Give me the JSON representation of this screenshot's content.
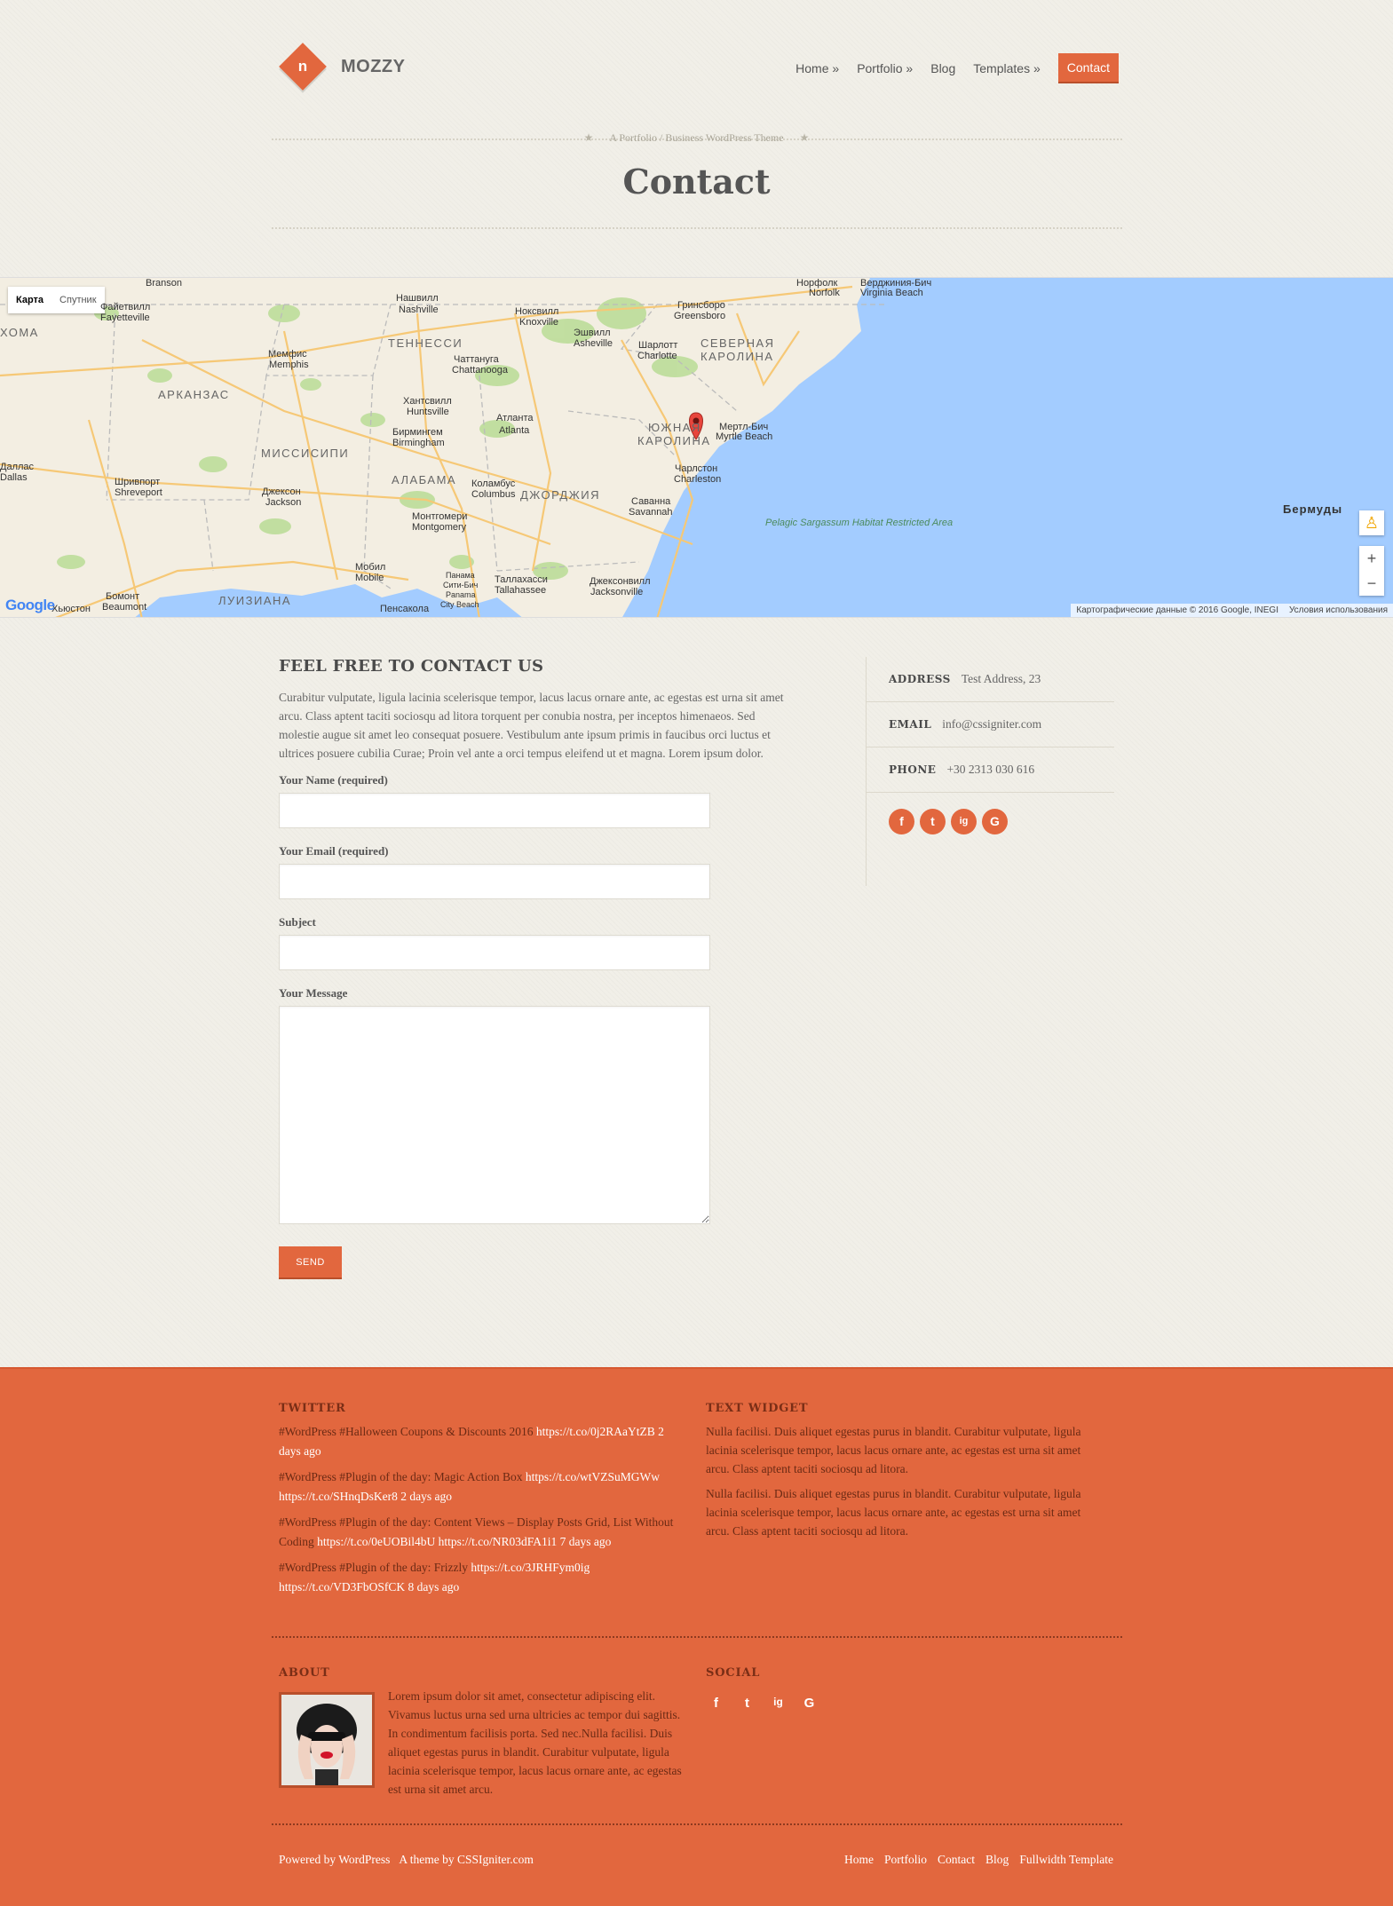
{
  "header": {
    "logo_glyph": "n",
    "logo_text": "MOZZY",
    "nav": [
      {
        "label": "Home »"
      },
      {
        "label": "Portfolio »"
      },
      {
        "label": "Blog"
      },
      {
        "label": "Templates »"
      },
      {
        "label": "Contact"
      }
    ],
    "tagline": "A Portfolio / Business WordPress Theme",
    "page_title": "Contact"
  },
  "map": {
    "type_tabs": [
      "Карта",
      "Спутник"
    ],
    "states": [
      "ТЕННЕССИ",
      "АРКАНЗАС",
      "МИССИСИПИ",
      "АЛАБАМА",
      "ДЖОРДЖИЯ",
      "ЛУИЗИАНА",
      "СЕВЕРНАЯ",
      "КАРОЛИНА",
      "ЮЖНАЯ",
      "КАРОЛИНА",
      "ХОМА"
    ],
    "cities": [
      "Нашвилл",
      "Nashville",
      "Ноксвилл",
      "Knoxville",
      "Гринсборо",
      "Greensboro",
      "Норфолк",
      "Norfolk",
      "Верджиния-Бич",
      "Virginia Beach",
      "Мемфис",
      "Memphis",
      "Чаттануга",
      "Chattanooga",
      "Эшвилл",
      "Asheville",
      "Шарлотт",
      "Charlotte",
      "Хантсвилл",
      "Huntsville",
      "Бирмингем",
      "Birmingham",
      "Атланта",
      "Atlanta",
      "Мертл-Бич",
      "Myrtle Beach",
      "Шривпорт",
      "Shreveport",
      "Джексон",
      "Jackson",
      "Коламбус",
      "Columbus",
      "Чарлстон",
      "Charleston",
      "Монтгомери",
      "Montgomery",
      "Саванна",
      "Savannah",
      "Даллас",
      "Dallas",
      "Мобил",
      "Mobile",
      "Панама",
      "Сити-Бич",
      "Panama",
      "City Beach",
      "Таллахасси",
      "Tallahassee",
      "Джексонвилл",
      "Jacksonville",
      "Бомонт",
      "Beaumont",
      "Пенсакола",
      "Хьюстон",
      "Branson",
      "Файетвилл",
      "Fayetteville"
    ],
    "sea_label": "Pelagic Sargassum Habitat Restricted Area",
    "island": "Бермуды",
    "google": "Google",
    "copyright": "Картографические данные © 2016 Google, INEGI",
    "terms": "Условия использования",
    "zoom_in": "+",
    "zoom_out": "−"
  },
  "contact": {
    "heading": "FEEL FREE TO CONTACT US",
    "intro": "Curabitur vulputate, ligula lacinia scelerisque tempor, lacus lacus ornare ante, ac egestas est urna sit amet arcu. Class aptent taciti sociosqu ad litora torquent per conubia nostra, per inceptos himenaeos. Sed molestie augue sit amet leo consequat posuere. Vestibulum ante ipsum primis in faucibus orci luctus et ultrices posuere cubilia Curae; Proin vel ante a orci tempus eleifend ut et magna. Lorem ipsum dolor.",
    "name_label": "Your Name (required)",
    "email_label": "Your Email (required)",
    "subject_label": "Subject",
    "message_label": "Your Message",
    "send_label": "SEND"
  },
  "info": {
    "address_key": "ADDRESS",
    "address_value": "Test Address, 23",
    "email_key": "EMAIL",
    "email_value": "info@cssigniter.com",
    "phone_key": "PHONE",
    "phone_value": "+30 2313 030 616",
    "social_glyphs": [
      "f",
      "t",
      "ig",
      "G"
    ]
  },
  "footer": {
    "twitter_title": "TWITTER",
    "tweets": [
      {
        "text": "#WordPress #Halloween Coupons & Discounts 2016 ",
        "link": "https://t.co/0j2RAaYtZB",
        "time": " 2 days ago"
      },
      {
        "text": "#WordPress #Plugin of the day: Magic Action Box ",
        "link": "https://t.co/wtVZSuMGWw https://t.co/SHnqDsKer8",
        "time": " 2 days ago"
      },
      {
        "text": "#WordPress #Plugin of the day: Content Views – Display Posts Grid, List Without Coding ",
        "link": "https://t.co/0eUOBil4bU https://t.co/NR03dFA1i1",
        "time": " 7 days ago"
      },
      {
        "text": "#WordPress #Plugin of the day: Frizzly ",
        "link": "https://t.co/3JRHFym0ig https://t.co/VD3FbOSfCK",
        "time": " 8 days ago"
      }
    ],
    "text_widget_title": "TEXT WIDGET",
    "text_widget_paragraphs": [
      "Nulla facilisi. Duis aliquet egestas purus in blandit. Curabitur vulputate, ligula lacinia scelerisque tempor, lacus lacus ornare ante, ac egestas est urna sit amet arcu. Class aptent taciti sociosqu ad litora.",
      "Nulla facilisi. Duis aliquet egestas purus in blandit. Curabitur vulputate, ligula lacinia scelerisque tempor, lacus lacus ornare ante, ac egestas est urna sit amet arcu. Class aptent taciti sociosqu ad litora."
    ],
    "about_title": "ABOUT",
    "about_text": "Lorem ipsum dolor sit amet, consectetur adipiscing elit. Vivamus luctus urna sed urna ultricies ac tempor dui sagittis. In condimentum facilisis porta. Sed nec.Nulla facilisi. Duis aliquet egestas purus in blandit. Curabitur vulputate, ligula lacinia scelerisque tempor, lacus lacus ornare ante, ac egestas est urna sit amet arcu.",
    "social_title": "SOCIAL",
    "social_glyphs": [
      "f",
      "t",
      "ig",
      "G"
    ],
    "powered": "Powered by WordPress",
    "theme_by": "A theme by CSSIgniter.com",
    "menu": [
      "Home",
      "Portfolio",
      "Contact",
      "Blog",
      "Fullwidth Template"
    ]
  },
  "colors": {
    "accent": "#e2673e",
    "accent_dark": "#b94f2b",
    "background": "#f1efe8",
    "water": "#a3ccff"
  }
}
